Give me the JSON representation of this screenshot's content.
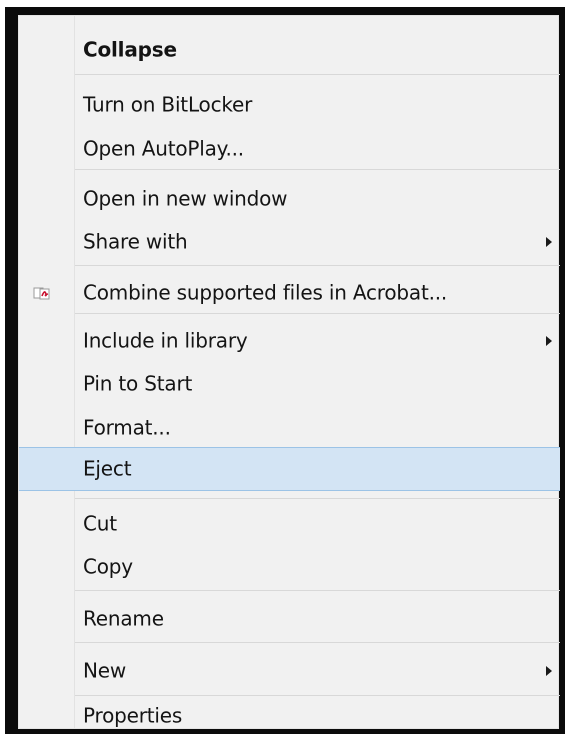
{
  "menu": {
    "items": [
      {
        "label": "Collapse"
      },
      {
        "label": "Turn on BitLocker"
      },
      {
        "label": "Open AutoPlay..."
      },
      {
        "label": "Open in new window"
      },
      {
        "label": "Share with"
      },
      {
        "label": "Combine supported files in Acrobat...",
        "icon": "acrobat-icon"
      },
      {
        "label": "Include in library"
      },
      {
        "label": "Pin to Start"
      },
      {
        "label": "Format..."
      },
      {
        "label": "Eject"
      },
      {
        "label": "Cut"
      },
      {
        "label": "Copy"
      },
      {
        "label": "Rename"
      },
      {
        "label": "New"
      },
      {
        "label": "Properties"
      }
    ],
    "highlighted_item": "Eject",
    "highlight_color": "#d3e4f4",
    "submenu_arrow_icon": "chevron-right-icon"
  }
}
